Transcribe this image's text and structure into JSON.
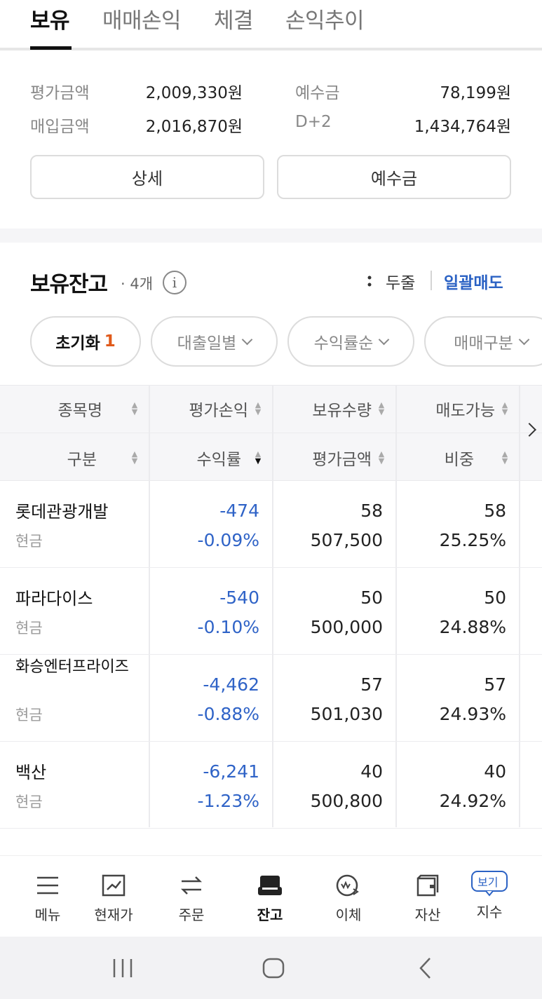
{
  "tabs": [
    "보유",
    "매매손익",
    "체결",
    "손익추이"
  ],
  "summary": {
    "eval_label": "평가금액",
    "eval_value": "2,009,330원",
    "deposit_label": "예수금",
    "deposit_value": "78,199원",
    "purchase_label": "매입금액",
    "purchase_value": "2,016,870원",
    "d2_label": "D+2",
    "d2_value": "1,434,764원",
    "detail_button": "상세",
    "deposit_button": "예수금"
  },
  "holdings": {
    "title": "보유잔고",
    "count": "· 4개",
    "info": "i",
    "two_line": "두줄",
    "bulk_sell": "일괄매도"
  },
  "filters": {
    "reset": "초기화",
    "reset_count": "1",
    "f1": "대출일별",
    "f2": "수익률순",
    "f3": "매매구분"
  },
  "table": {
    "h1a": "종목명",
    "h2a": "평가손익",
    "h3a": "보유수량",
    "h4a": "매도가능",
    "h1b": "구분",
    "h2b": "수익률",
    "h3b": "평가금액",
    "h4b": "비중",
    "rows": [
      {
        "name": "롯데관광개발",
        "kind": "현금",
        "pl": "-474",
        "rate": "-0.09%",
        "qty": "58",
        "eval": "507,500",
        "sellable": "58",
        "weight": "25.25%"
      },
      {
        "name": "파라다이스",
        "kind": "현금",
        "pl": "-540",
        "rate": "-0.10%",
        "qty": "50",
        "eval": "500,000",
        "sellable": "50",
        "weight": "24.88%"
      },
      {
        "name": "화승엔터프라이즈",
        "kind": "현금",
        "pl": "-4,462",
        "rate": "-0.88%",
        "qty": "57",
        "eval": "501,030",
        "sellable": "57",
        "weight": "24.93%"
      },
      {
        "name": "백산",
        "kind": "현금",
        "pl": "-6,241",
        "rate": "-1.23%",
        "qty": "40",
        "eval": "500,800",
        "sellable": "40",
        "weight": "24.92%"
      }
    ]
  },
  "nav": {
    "menu": "메뉴",
    "price": "현재가",
    "order": "주문",
    "balance": "잔고",
    "transfer": "이체",
    "assets": "자산",
    "index_badge": "보기",
    "index": "지수"
  },
  "icons": {
    "menu": "hamburger-icon",
    "price": "chart-icon",
    "order": "swap-icon",
    "balance": "wallet-icon",
    "transfer": "transfer-icon",
    "assets": "folder-icon"
  },
  "colors": {
    "accent": "#2b62c4",
    "negative": "#2f63c7",
    "badge": "#e05a1b"
  }
}
